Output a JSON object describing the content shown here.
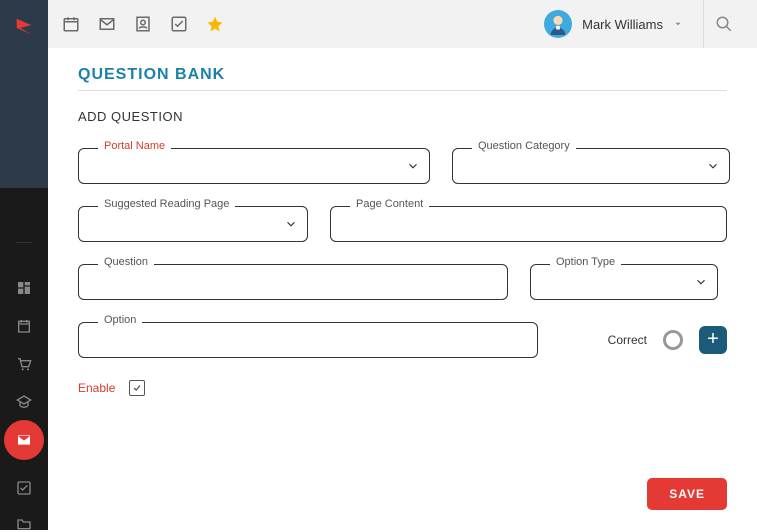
{
  "user": {
    "name": "Mark Williams"
  },
  "page": {
    "title": "QUESTION BANK",
    "subtitle": "ADD QUESTION"
  },
  "fields": {
    "portal_name": {
      "label": "Portal Name",
      "value": ""
    },
    "question_category": {
      "label": "Question Category",
      "value": ""
    },
    "suggested_reading_page": {
      "label": "Suggested Reading Page",
      "value": ""
    },
    "page_content": {
      "label": "Page Content",
      "value": ""
    },
    "question": {
      "label": "Question",
      "value": ""
    },
    "option_type": {
      "label": "Option Type",
      "value": ""
    },
    "option": {
      "label": "Option",
      "value": ""
    }
  },
  "correct_label": "Correct",
  "enable": {
    "label": "Enable",
    "checked": true
  },
  "buttons": {
    "save": "SAVE",
    "add": "+"
  },
  "colors": {
    "brand": "#e53935",
    "title": "#1b81a8",
    "accent": "#1c5a7a"
  }
}
